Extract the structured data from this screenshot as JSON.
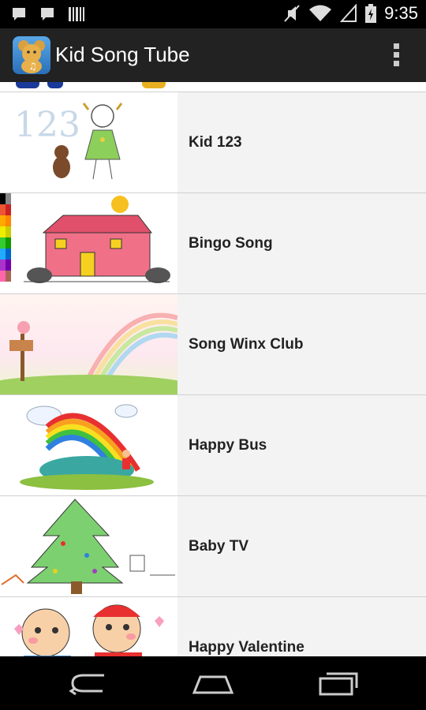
{
  "status": {
    "time": "9:35"
  },
  "app": {
    "title": "Kid Song Tube"
  },
  "songs": [
    {
      "title": "Kid 123",
      "thumb_text": "123"
    },
    {
      "title": "Bingo Song"
    },
    {
      "title": "Song Winx Club"
    },
    {
      "title": "Happy Bus"
    },
    {
      "title": "Baby TV"
    },
    {
      "title": "Happy Valentine"
    }
  ],
  "colors": {
    "actionbar": "#222222",
    "list_bg": "#f3f3f3",
    "divider": "#d0d0d0"
  },
  "icons": [
    "notification-icon",
    "notification-icon",
    "barcode-icon",
    "mute-icon",
    "wifi-icon",
    "signal-icon",
    "battery-icon",
    "overflow-menu-icon",
    "back-icon",
    "home-icon",
    "recent-apps-icon"
  ]
}
